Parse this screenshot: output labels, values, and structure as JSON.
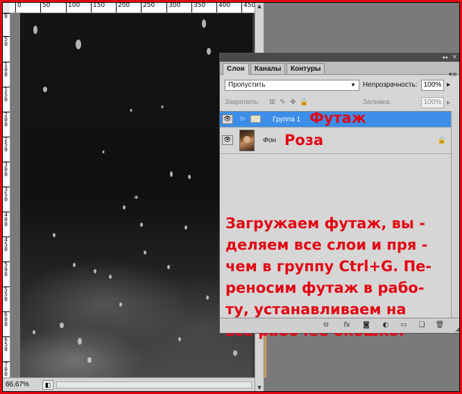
{
  "ruler": {
    "top_ticks": [
      "0",
      "50",
      "100",
      "150",
      "200",
      "250",
      "300",
      "350",
      "400",
      "450"
    ],
    "left_ticks": [
      "0",
      "5 0",
      "1 0 0",
      "1 5 0",
      "2 0 0",
      "2 5 0",
      "3 0 0",
      "3 5 0",
      "4 0 0",
      "4 5 0",
      "5 0 0",
      "5 5 0",
      "6 0 0",
      "6 5 0",
      "7 0 0"
    ]
  },
  "status_bar": {
    "zoom": "66,67%",
    "icon": "document-info-icon"
  },
  "layers_panel": {
    "tabs": [
      {
        "label": "Слои",
        "active": true
      },
      {
        "label": "Каналы",
        "active": false
      },
      {
        "label": "Контуры",
        "active": false
      }
    ],
    "collapse_glyph": "◂◂",
    "close_glyph": "✕",
    "menu_glyph": "▾≡",
    "blend_mode": "Пропустить",
    "opacity_label": "Непрозрачность:",
    "opacity_value": "100%",
    "lock_label": "Закрепить:",
    "fill_label": "Заливка:",
    "fill_value": "100%",
    "layers": [
      {
        "name": "Группа 1",
        "type": "group",
        "selected": true,
        "visible": true
      },
      {
        "name": "Фон",
        "type": "image",
        "selected": false,
        "visible": true,
        "locked": true
      }
    ],
    "footer_icons": [
      "link-icon",
      "fx-icon",
      "mask-icon",
      "adjustment-icon",
      "new-group-icon",
      "new-layer-icon",
      "trash-icon"
    ],
    "footer_glyphs": [
      "⊖",
      "fx",
      "◙",
      "◐",
      "▭",
      "❏",
      "🗑"
    ]
  },
  "annotations": {
    "group_label": "Футаж",
    "background_label": "Роза",
    "instructions": [
      "Загружаем футаж, вы -",
      "деляем все слои и пря -",
      "чем в группу Ctrl+G. Пе-",
      "реносим футаж в рабо-",
      "ту, устанавливаем на",
      "все рабочее окошко."
    ]
  },
  "colors": {
    "frame": "#e30613",
    "selection": "#3d8ee9",
    "annotation_text": "#e30613",
    "panel_bg": "#d6d6d6"
  }
}
